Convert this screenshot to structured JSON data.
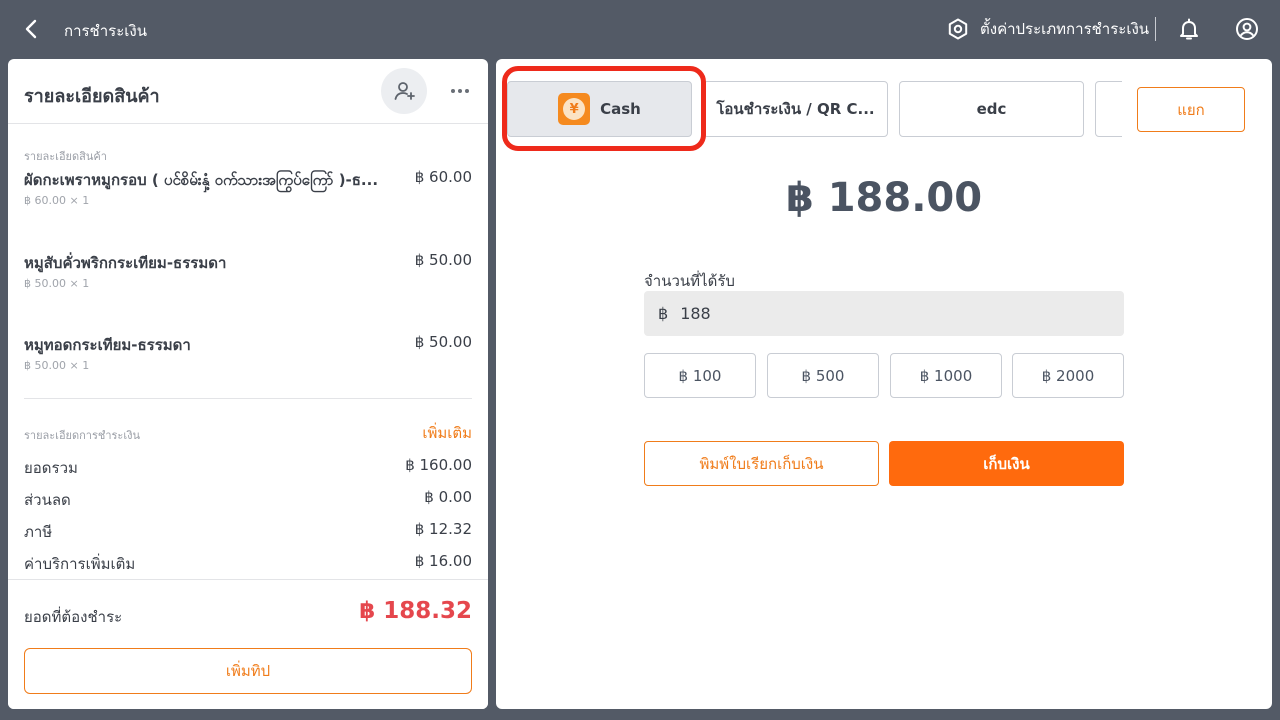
{
  "topbar": {
    "title": "การชำระเงิน",
    "settings_label": "ตั้งค่าประเภทการชำระเงิน"
  },
  "order": {
    "title": "รายละเอียดสินค้า",
    "section_caption": "รายละเอียดสินค้า",
    "items": [
      {
        "name": "ผัดกะเพราหมูกรอบ ( ပင်စိမ်းနှံ့ ဝက်သားအကြွပ်ကြော် )-ธ...",
        "price": "฿ 60.00",
        "qty": "฿ 60.00 × 1"
      },
      {
        "name": "หมูสับคั่วพริกกระเทียม-ธรรมดา",
        "price": "฿ 50.00",
        "qty": "฿ 50.00 × 1"
      },
      {
        "name": "หมูทอดกระเทียม-ธรรมดา",
        "price": "฿ 50.00",
        "qty": "฿ 50.00 × 1"
      }
    ],
    "payment_caption": "รายละเอียดการชำระเงิน",
    "add_more": "เพิ่มเติม",
    "summary": [
      {
        "label": "ยอดรวม",
        "value": "฿ 160.00"
      },
      {
        "label": "ส่วนลด",
        "value": "฿ 0.00"
      },
      {
        "label": "ภาษี",
        "value": "฿ 12.32"
      },
      {
        "label": "ค่าบริการเพิ่มเติม",
        "value": "฿ 16.00"
      }
    ],
    "due_label": "ยอดที่ต้องชำระ",
    "due_value": "฿ 188.32",
    "tip_label": "เพิ่มทิป"
  },
  "payment": {
    "methods": [
      {
        "label": "Cash",
        "active": true
      },
      {
        "label": "โอนชำระเงิน / QR C..."
      },
      {
        "label": "edc"
      },
      {
        "label": ""
      }
    ],
    "cash_icon_glyph": "¥",
    "split_label": "แยก",
    "total": "฿ 188.00",
    "received_label": "จำนวนที่ได้รับ",
    "received_currency": "฿",
    "received_value": "188",
    "quick_amounts": [
      "฿ 100",
      "฿ 500",
      "฿ 1000",
      "฿ 2000"
    ],
    "print_label": "พิมพ์ใบเรียกเก็บเงิน",
    "collect_label": "เก็บเงิน"
  },
  "colors": {
    "accent": "#f07c1a",
    "primary_button": "#ff6a0d",
    "due_amount": "#e5474d",
    "highlight": "#ee2a1b",
    "background": "#535a66"
  }
}
